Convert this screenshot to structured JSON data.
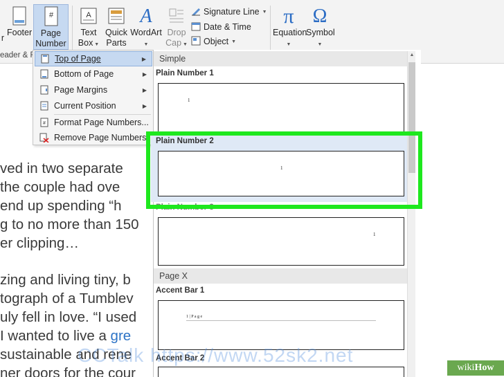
{
  "ribbon": {
    "footer_label": "Footer",
    "page_number_label_1": "Page",
    "page_number_label_2": "Number",
    "text_box_label_1": "Text",
    "text_box_label_2": "Box",
    "quick_parts_label_1": "Quick",
    "quick_parts_label_2": "Parts",
    "wordart_label": "WordArt",
    "drop_cap_label_1": "Drop",
    "drop_cap_label_2": "Cap",
    "signature_line_label": "Signature Line",
    "date_time_label": "Date & Time",
    "object_label": "Object",
    "equation_label": "Equation",
    "symbol_label": "Symbol",
    "header_footer_group": "eader & F",
    "left_cut_label": "r"
  },
  "menu": {
    "items": [
      {
        "label": "Top of Page"
      },
      {
        "label": "Bottom of Page"
      },
      {
        "label": "Page Margins"
      },
      {
        "label": "Current Position"
      },
      {
        "label": "Format Page Numbers..."
      },
      {
        "label": "Remove Page Numbers"
      }
    ]
  },
  "gallery": {
    "section_simple": "Simple",
    "section_page_x": "Page X",
    "items": [
      {
        "name": "Plain Number 1",
        "sample": "1"
      },
      {
        "name": "Plain Number 2",
        "sample": "1"
      },
      {
        "name": "Plain Number 3",
        "sample": "1"
      },
      {
        "name": "Accent Bar 1",
        "sample": "1 | P a g e"
      },
      {
        "name": "Accent Bar 2"
      }
    ]
  },
  "document": {
    "lines": [
      {
        "text": "ved in two separate"
      },
      {
        "text": " the couple had ove"
      },
      {
        "text": " end up spending “h"
      },
      {
        "text": "g to no more than 150"
      },
      {
        "text": "er clipping…"
      },
      {
        "text": "zing and living tiny, b"
      },
      {
        "text": "tograph of a Tumblev"
      },
      {
        "text": "uly fell in love. “I used"
      },
      {
        "text": "I wanted to live a "
      },
      {
        "text": "sustainable and rene"
      },
      {
        "text": "ner doors for the cour"
      }
    ],
    "link_word": "gre"
  },
  "watermark": "CCTalk https://www.52sk2.net",
  "badge": {
    "wiki": "wiki",
    "how": "How"
  },
  "colors": {
    "highlight": "#1ee81e",
    "menu_selected": "#c6d9f1",
    "link": "#2e74c6"
  }
}
